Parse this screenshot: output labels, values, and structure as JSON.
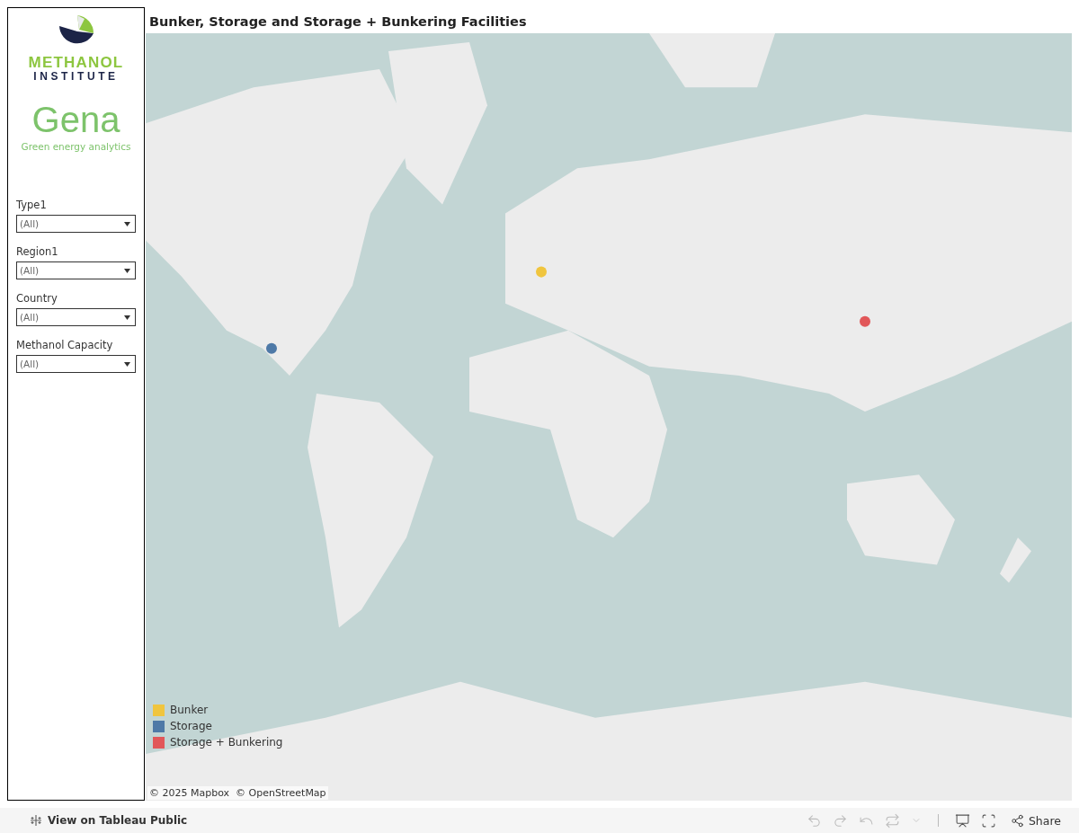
{
  "sidebar": {
    "logo": {
      "line1": "METHANOL",
      "line2": "INSTITUTE"
    },
    "brand": {
      "name": "Gena",
      "tagline": "Green energy analytics"
    },
    "filters": [
      {
        "label": "Type1",
        "value": "(All)"
      },
      {
        "label": "Region1",
        "value": "(All)"
      },
      {
        "label": "Country",
        "value": "(All)"
      },
      {
        "label": "Methanol Capacity",
        "value": "(All)"
      }
    ]
  },
  "title": "Bunker, Storage and Storage + Bunkering Facilities",
  "map": {
    "kind": "picture",
    "legend": [
      {
        "label": "Bunker",
        "color": "#f0c53e"
      },
      {
        "label": "Storage",
        "color": "#4e79a7"
      },
      {
        "label": "Storage + Bunkering",
        "color": "#e15759"
      }
    ],
    "attribution": "© 2025 Mapbox  © OpenStreetMap"
  },
  "toolbar": {
    "link": "View on Tableau Public",
    "buttons": [
      {
        "kind": "undo",
        "disabled": true
      },
      {
        "kind": "redo",
        "disabled": true
      },
      {
        "kind": "revert",
        "disabled": true
      },
      {
        "kind": "refresh",
        "disabled": true
      },
      {
        "kind": "caret",
        "disabled": true
      },
      {
        "kind": "download",
        "disabled": false
      },
      {
        "kind": "fullscreen",
        "disabled": false
      }
    ],
    "share": "Share"
  }
}
